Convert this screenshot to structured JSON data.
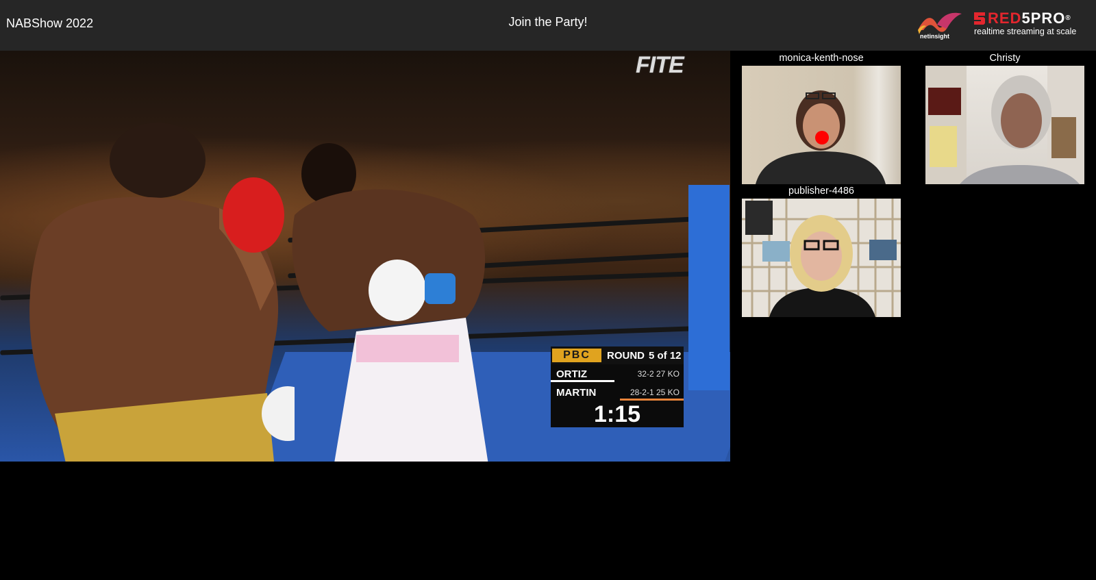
{
  "header": {
    "event_title": "NABShow 2022",
    "party_title": "Join the Party!",
    "partner_logo": {
      "name": "netinsight-logo",
      "text": "netinsight"
    },
    "brand_logo": {
      "name": "red5pro-logo",
      "text_red": "RED",
      "text_white": "5PRO",
      "trademark": "®",
      "tagline": "realtime streaming at scale"
    }
  },
  "main_video": {
    "watermark": "FITE",
    "scorebug": {
      "league": "PBC",
      "round_label": "ROUND",
      "round_value": "5 of 12",
      "fighters": [
        {
          "name": "ORTIZ",
          "record": "32-2 27 KO",
          "bar_color": "#ffffff",
          "bar_fraction": 0.48
        },
        {
          "name": "MARTIN",
          "record": "28-2-1 25 KO",
          "bar_color": "#e8843a",
          "bar_fraction": 0.48
        }
      ],
      "clock": "1:15"
    }
  },
  "participants": [
    {
      "name": "monica-kenth-nose"
    },
    {
      "name": "Christy"
    },
    {
      "name": "publisher-4486"
    }
  ],
  "colors": {
    "header_bg": "#262626",
    "page_bg": "#000000",
    "brand_red": "#e3262e",
    "pbc_gold": "#e0a31f"
  }
}
